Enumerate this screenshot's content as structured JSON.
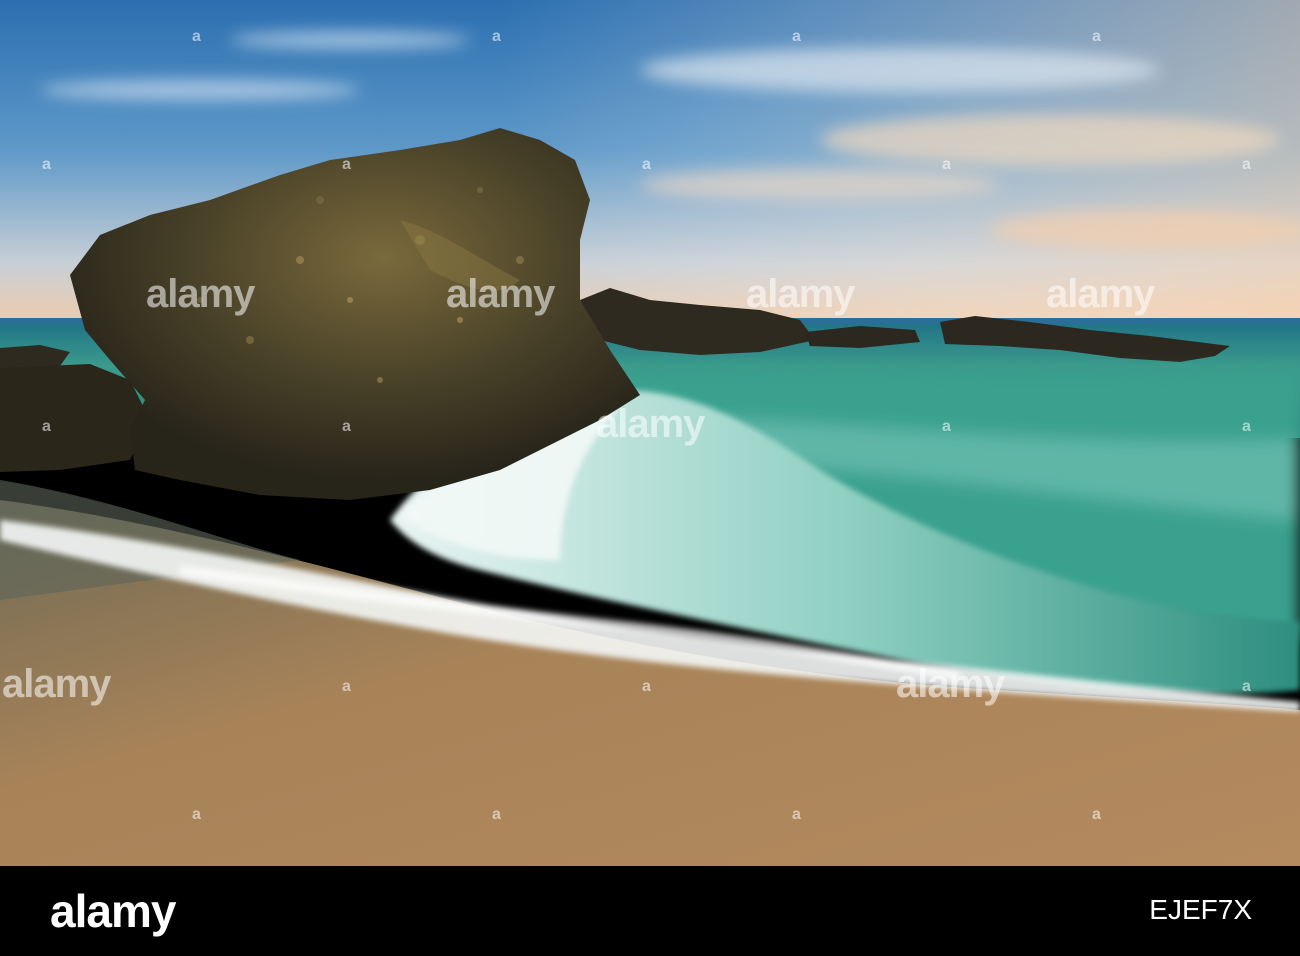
{
  "watermark": {
    "word": "alamy",
    "dot": "a"
  },
  "footer": {
    "logo": "alamy",
    "image_id": "EJEF7X"
  },
  "colors": {
    "sky_top": "#2f77b5",
    "sky_horizon": "#f4c9a4",
    "sea": "#2f9a86",
    "sand": "#a07c52",
    "rock": "#3b3724",
    "footer": "#000000"
  }
}
